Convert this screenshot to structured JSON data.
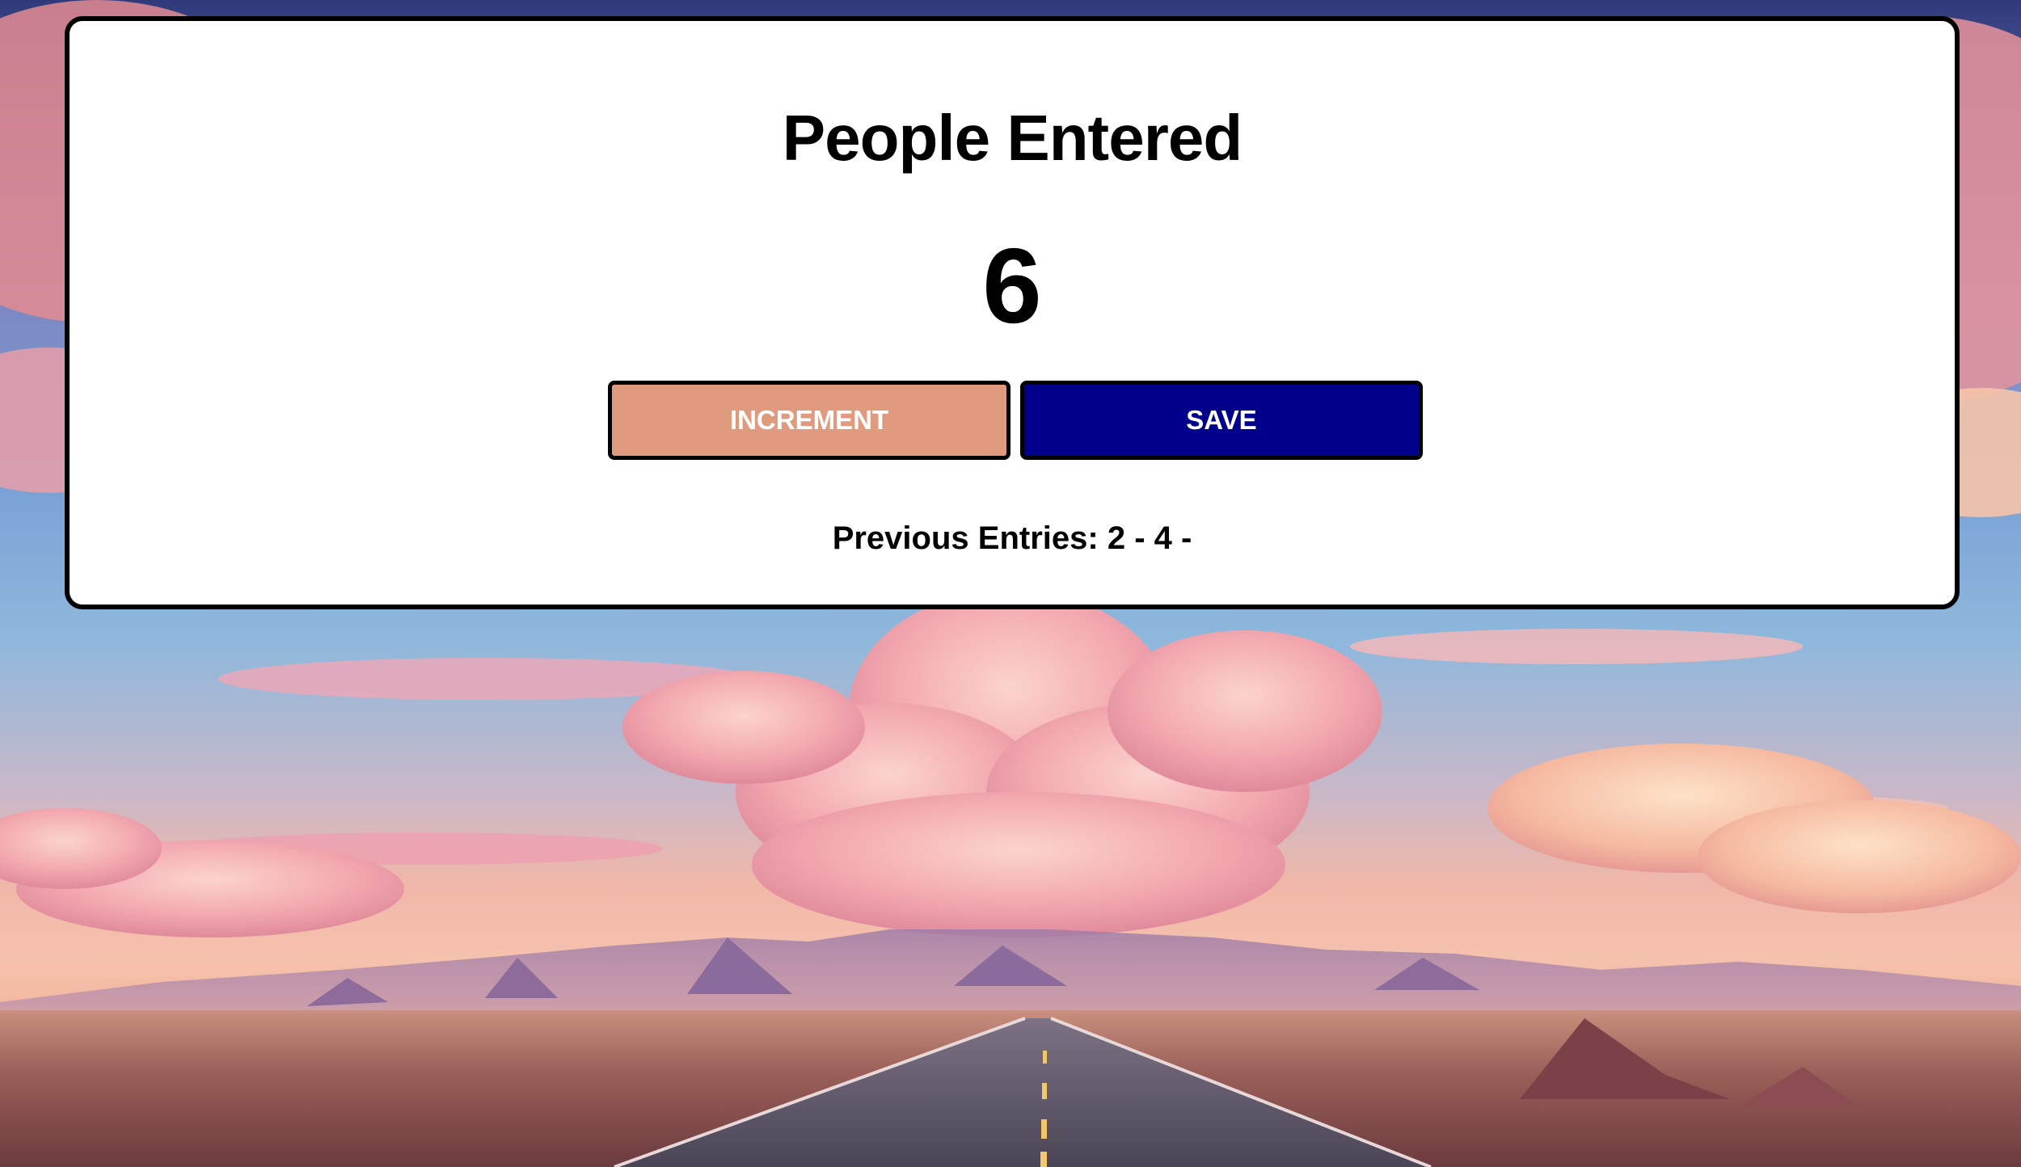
{
  "app": {
    "title": "People Entered",
    "count": "6",
    "buttons": {
      "increment_label": "INCREMENT",
      "save_label": "SAVE"
    },
    "previous_entries_label": "Previous Entries:",
    "previous_entries": "2 - 4 -"
  },
  "colors": {
    "increment_button": "#e09b7f",
    "save_button": "#00008b",
    "card_background": "#ffffff",
    "card_border": "#000000"
  }
}
